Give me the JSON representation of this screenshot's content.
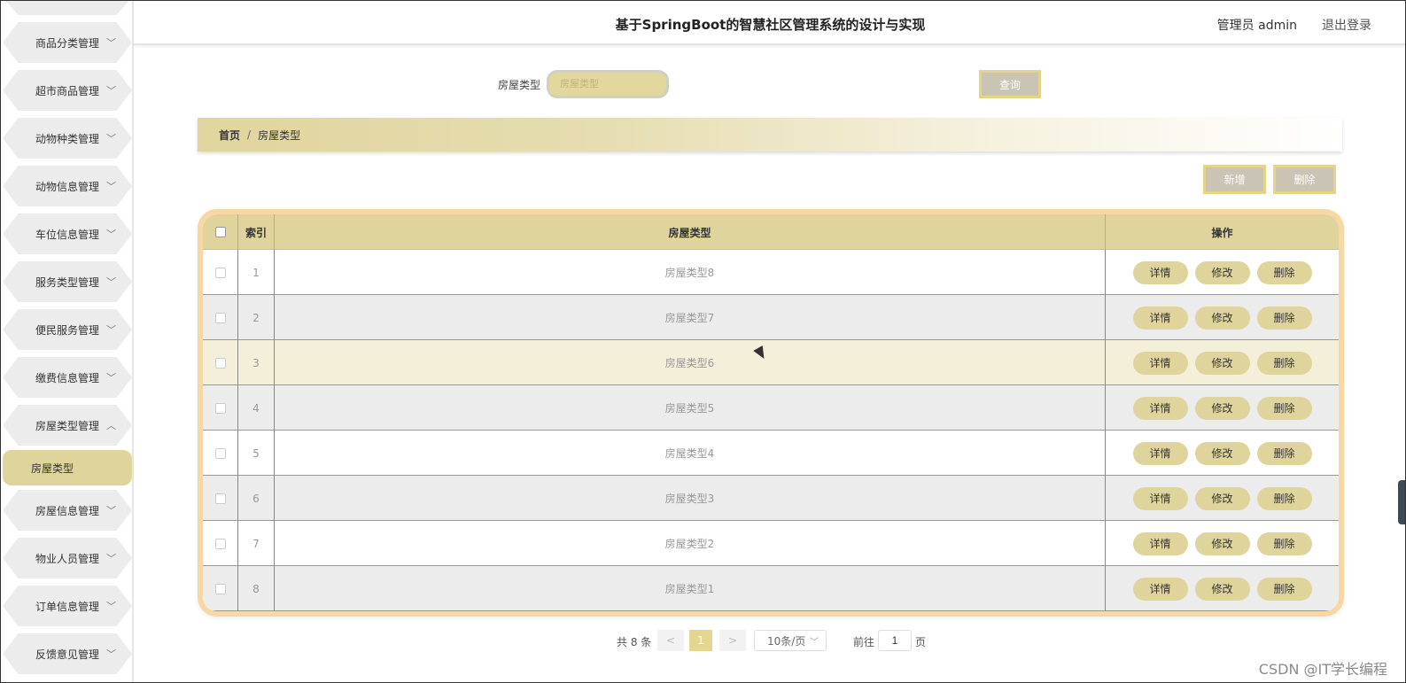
{
  "header": {
    "title": "基于SpringBoot的智慧社区管理系统的设计与实现",
    "user": "管理员 admin",
    "logout": "退出登录"
  },
  "sidebar": {
    "items": [
      {
        "label": "商品分类管理",
        "chevron": "chevron-down-icon"
      },
      {
        "label": "超市商品管理",
        "chevron": "chevron-down-icon"
      },
      {
        "label": "动物种类管理",
        "chevron": "chevron-down-icon"
      },
      {
        "label": "动物信息管理",
        "chevron": "chevron-down-icon"
      },
      {
        "label": "车位信息管理",
        "chevron": "chevron-down-icon"
      },
      {
        "label": "服务类型管理",
        "chevron": "chevron-down-icon"
      },
      {
        "label": "便民服务管理",
        "chevron": "chevron-down-icon"
      },
      {
        "label": "缴费信息管理",
        "chevron": "chevron-down-icon"
      },
      {
        "label": "房屋类型管理",
        "chevron": "chevron-up-icon"
      },
      {
        "label": "房屋信息管理",
        "chevron": "chevron-down-icon"
      },
      {
        "label": "物业人员管理",
        "chevron": "chevron-down-icon"
      },
      {
        "label": "订单信息管理",
        "chevron": "chevron-down-icon"
      },
      {
        "label": "反馈意见管理",
        "chevron": "chevron-down-icon"
      }
    ],
    "active_sub": "房屋类型"
  },
  "search": {
    "label": "房屋类型",
    "placeholder": "房屋类型",
    "button": "查询"
  },
  "breadcrumb": {
    "home": "首页",
    "separator": "/",
    "current": "房屋类型"
  },
  "actions": {
    "add": "新增",
    "delete": "删除"
  },
  "table": {
    "headers": {
      "index": "索引",
      "type": "房屋类型",
      "ops": "操作"
    },
    "op_labels": {
      "detail": "详情",
      "edit": "修改",
      "delete": "删除"
    },
    "rows": [
      {
        "index": "1",
        "type": "房屋类型8"
      },
      {
        "index": "2",
        "type": "房屋类型7"
      },
      {
        "index": "3",
        "type": "房屋类型6"
      },
      {
        "index": "4",
        "type": "房屋类型5"
      },
      {
        "index": "5",
        "type": "房屋类型4"
      },
      {
        "index": "6",
        "type": "房屋类型3"
      },
      {
        "index": "7",
        "type": "房屋类型2"
      },
      {
        "index": "8",
        "type": "房屋类型1"
      }
    ]
  },
  "pagination": {
    "total": "共 8 条",
    "prev": "<",
    "current": "1",
    "next": ">",
    "page_size": "10条/页",
    "goto": "前往",
    "goto_value": "1",
    "page_suffix": "页"
  },
  "watermark": "CSDN @IT学长编程",
  "colors": {
    "accent": "#dfd49b",
    "table_border": "#f7d7a3",
    "row_gray": "#ececec",
    "row_hover": "#f4efd8"
  }
}
